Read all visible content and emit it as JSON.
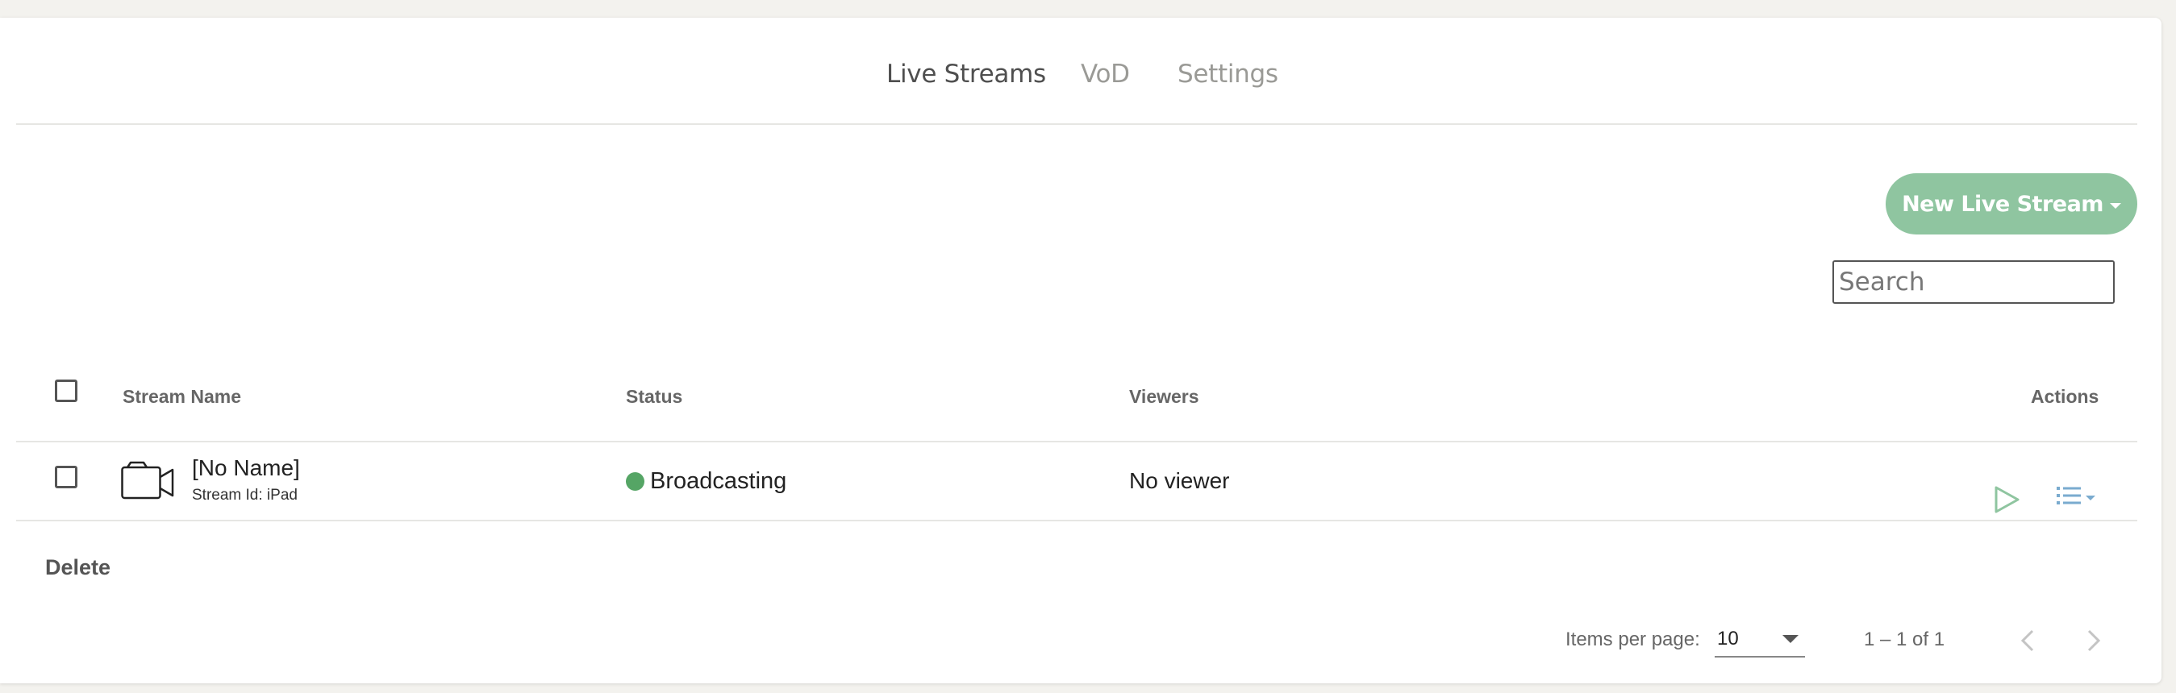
{
  "tabs": [
    {
      "label": "Live Streams",
      "active": true
    },
    {
      "label": "VoD",
      "active": false
    },
    {
      "label": "Settings",
      "active": false
    }
  ],
  "toolbar": {
    "new_stream_label": "New Live Stream",
    "search_placeholder": "Search"
  },
  "table": {
    "columns": [
      "Stream Name",
      "Status",
      "Viewers",
      "Actions"
    ],
    "rows": [
      {
        "name": "[No Name]",
        "stream_id": "Stream Id: iPad",
        "status": "Broadcasting",
        "status_color": "#55a565",
        "viewers": "No viewer"
      }
    ]
  },
  "bulk": {
    "delete_label": "Delete"
  },
  "pagination": {
    "items_per_page_label": "Items per page:",
    "items_per_page_value": "10",
    "range_label": "1 – 1 of 1"
  },
  "icons": {
    "row": "video-camera-icon",
    "play": "play-icon",
    "menu": "list-menu-icon",
    "prev": "chevron-left-icon",
    "next": "chevron-right-icon"
  },
  "colors": {
    "accent": "#8fc5a0",
    "status_ok": "#55a565",
    "action_blue": "#7aabcf"
  }
}
